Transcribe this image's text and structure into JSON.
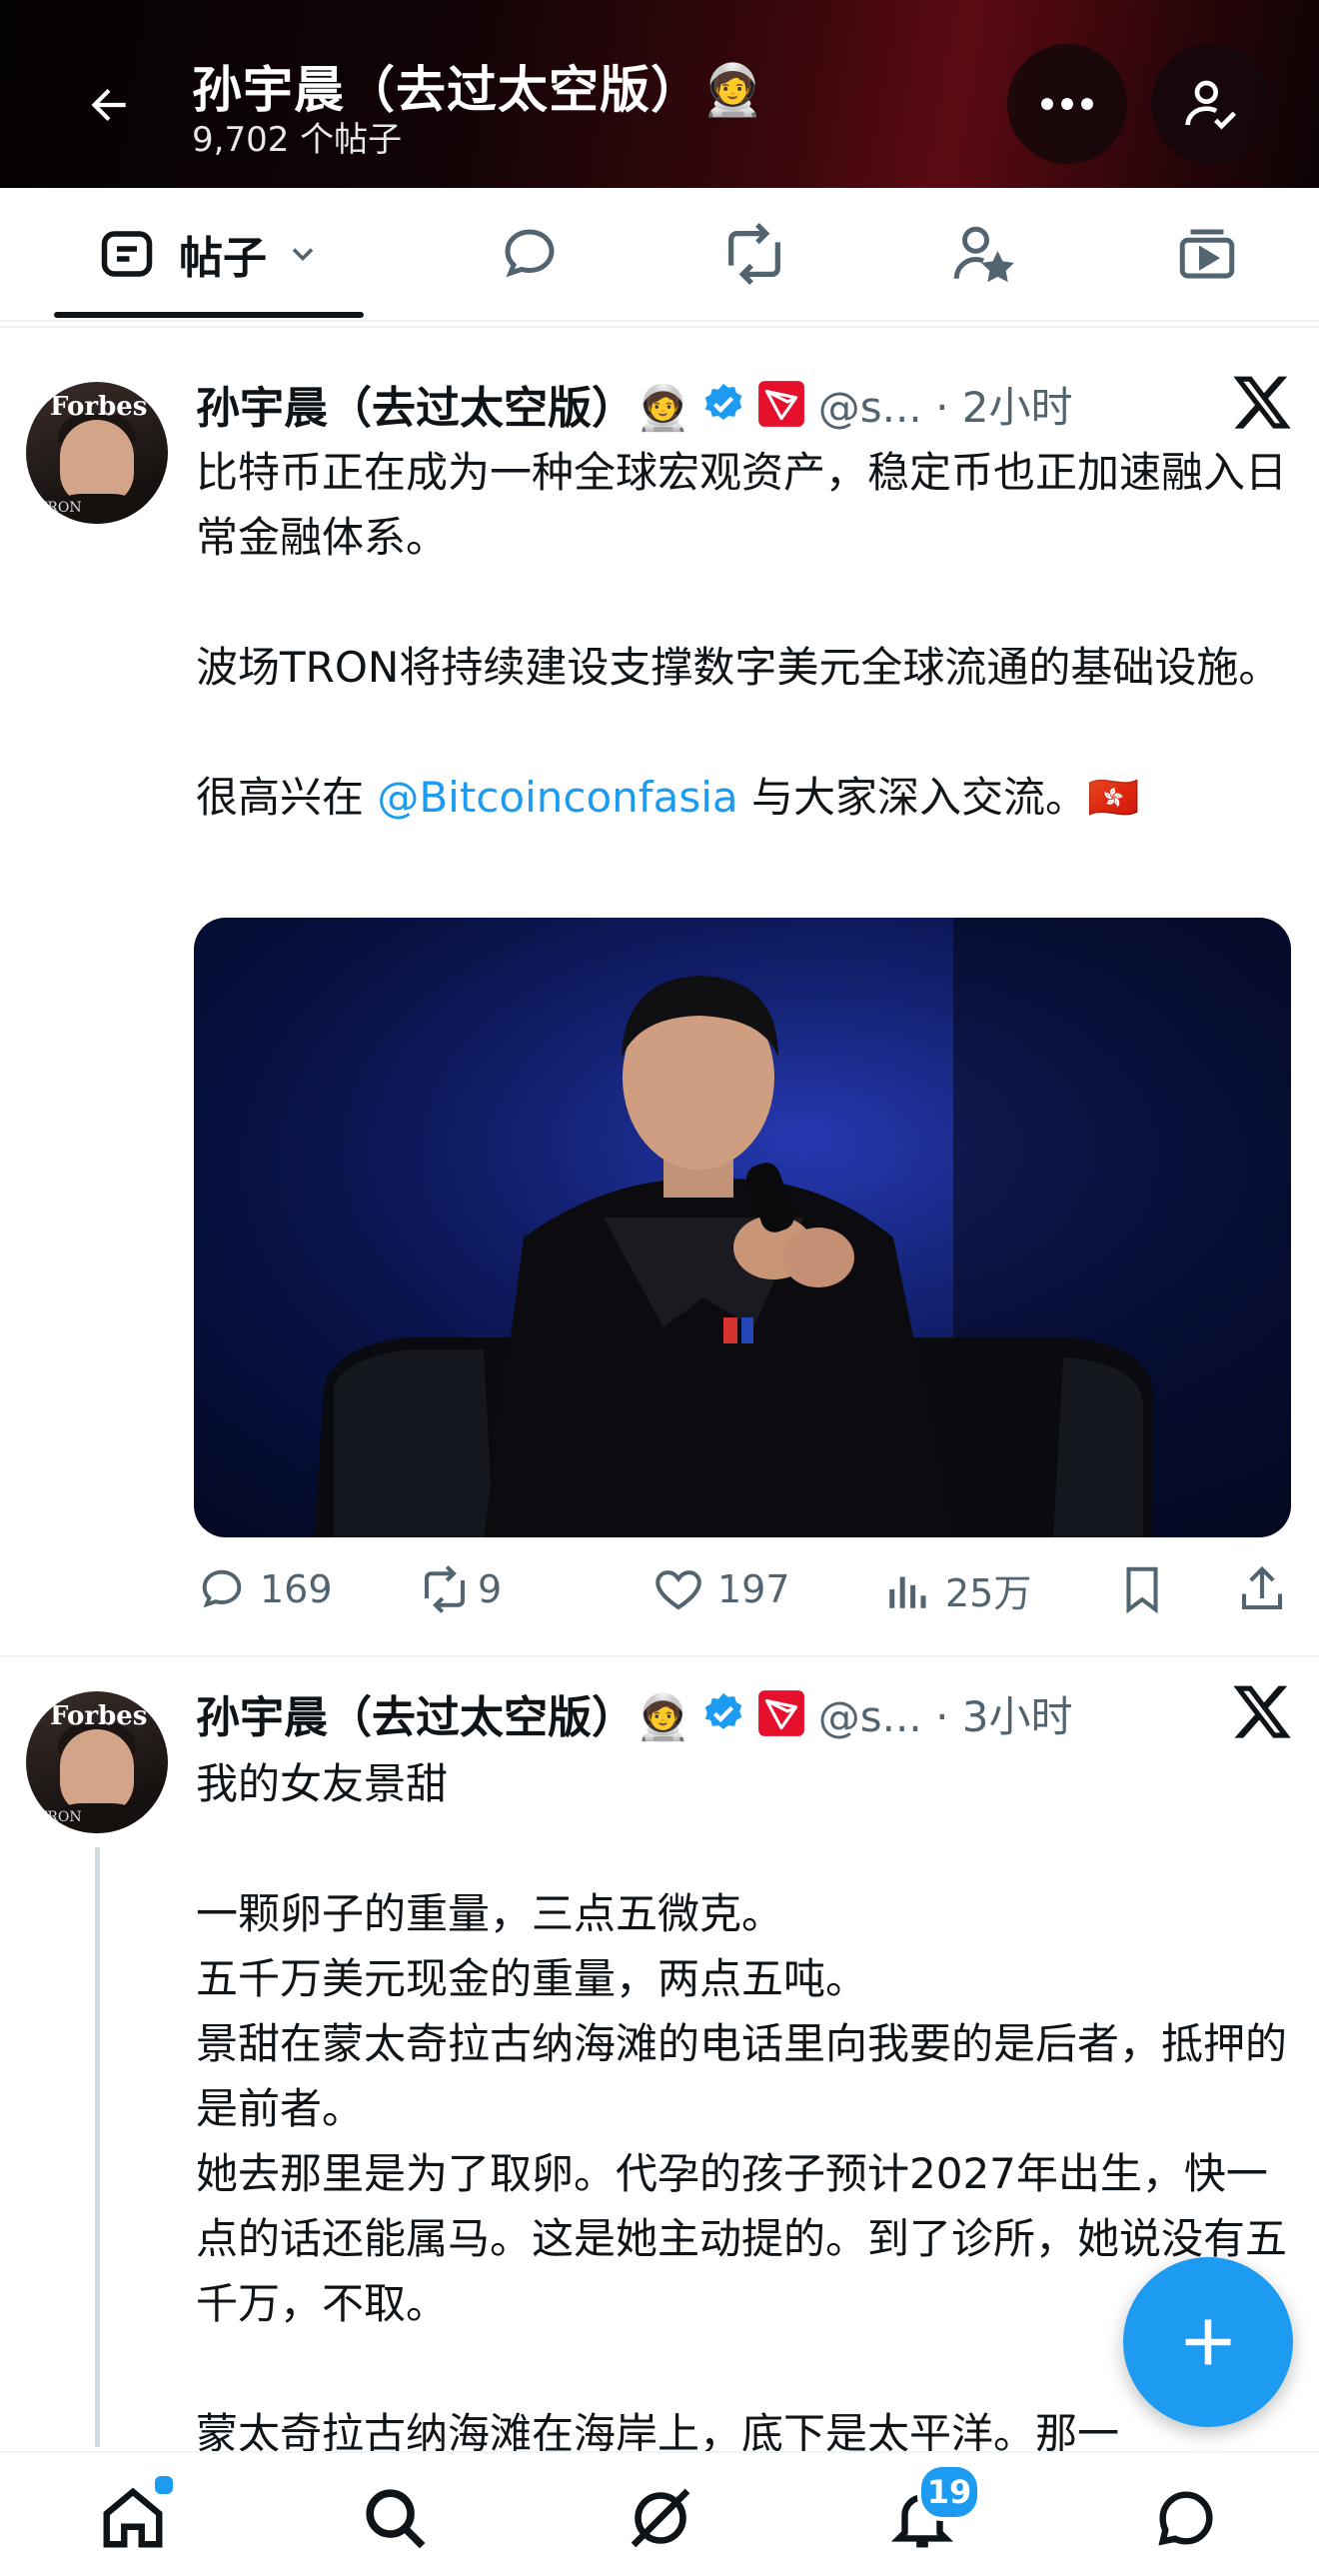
{
  "header": {
    "title": "孙宇晨（去过太空版）🧑‍🚀",
    "post_count": "9,702 个帖子"
  },
  "tabs": {
    "posts_label": "帖子"
  },
  "posts": [
    {
      "author": "孙宇晨（去过太空版）🧑‍🚀",
      "handle_time": "@s... · 2小时",
      "paragraphs": [
        "比特币正在成为一种全球宏观资产，稳定币也正加速融入日常金融体系。",
        "波场TRON将持续建设支撑数字美元全球流通的基础设施。"
      ],
      "line3_prefix": "很高兴在 ",
      "mention": "@Bitcoinconfasia",
      "line3_suffix": " 与大家深入交流。🇭🇰",
      "replies": "169",
      "reposts": "9",
      "likes": "197",
      "views": "25万"
    },
    {
      "author": "孙宇晨（去过太空版）🧑‍🚀",
      "handle_time": "@s... · 3小时",
      "title_line": "我的女友景甜",
      "lines": [
        "一颗卵子的重量，三点五微克。",
        "五千万美元现金的重量，两点五吨。",
        "景甜在蒙太奇拉古纳海滩的电话里向我要的是后者，抵押的是前者。",
        "她去那里是为了取卵。代孕的孩子预计2027年出生，快一点的话还能属马。这是她主动提的。到了诊所，她说没有五千万，不取。",
        "蒙太奇拉古纳海滩在海岸上，底下是太平洋。那一"
      ]
    }
  ],
  "avatar_text": {
    "magazine": "Forbes",
    "cover_text": "TRON"
  },
  "bottom_nav": {
    "notifications_badge": "19"
  },
  "colors": {
    "accent": "#1d9bf0",
    "text": "#0f1419",
    "muted": "#536471",
    "tron_red": "#e5102b"
  }
}
